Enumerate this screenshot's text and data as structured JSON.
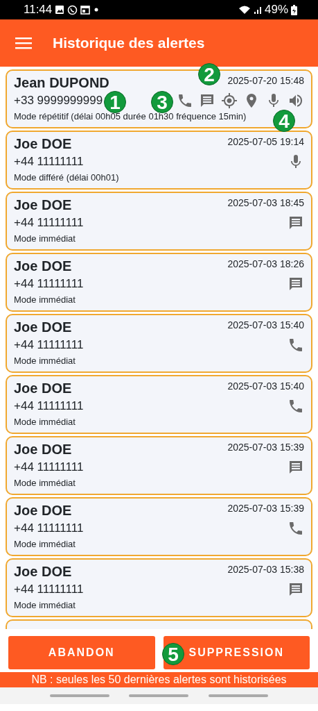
{
  "status_bar": {
    "time": "11:44",
    "battery": "49%"
  },
  "header": {
    "title": "Historique des alertes"
  },
  "alerts": [
    {
      "name": "Jean DUPOND",
      "phone": "+33 9999999999",
      "date": "2025-07-20 15:48",
      "mode": "Mode répétitif (délai 00h05 durée 01h30 fréquence 15min)",
      "icons": [
        {
          "kind": "call"
        },
        {
          "kind": "message"
        },
        {
          "kind": "target"
        },
        {
          "kind": "pin"
        },
        {
          "kind": "mic"
        },
        {
          "kind": "speaker"
        }
      ]
    },
    {
      "name": "Joe DOE",
      "phone": "+44 11111111",
      "date": "2025-07-05 19:14",
      "mode": "Mode différé (délai 00h01)",
      "icons": [
        {
          "kind": "mic"
        }
      ]
    },
    {
      "name": "Joe DOE",
      "phone": "+44 11111111",
      "date": "2025-07-03 18:45",
      "mode": "Mode immédiat",
      "icons": [
        {
          "kind": "message"
        }
      ]
    },
    {
      "name": "Joe DOE",
      "phone": "+44 11111111",
      "date": "2025-07-03 18:26",
      "mode": "Mode immédiat",
      "icons": [
        {
          "kind": "message"
        }
      ]
    },
    {
      "name": "Joe DOE",
      "phone": "+44 11111111",
      "date": "2025-07-03 15:40",
      "mode": "Mode immédiat",
      "icons": [
        {
          "kind": "call"
        }
      ]
    },
    {
      "name": "Joe DOE",
      "phone": "+44 11111111",
      "date": "2025-07-03 15:40",
      "mode": "Mode immédiat",
      "icons": [
        {
          "kind": "call"
        }
      ]
    },
    {
      "name": "Joe DOE",
      "phone": "+44 11111111",
      "date": "2025-07-03 15:39",
      "mode": "Mode immédiat",
      "icons": [
        {
          "kind": "message"
        }
      ]
    },
    {
      "name": "Joe DOE",
      "phone": "+44 11111111",
      "date": "2025-07-03 15:39",
      "mode": "Mode immédiat",
      "icons": [
        {
          "kind": "call"
        }
      ]
    },
    {
      "name": "Joe DOE",
      "phone": "+44 11111111",
      "date": "2025-07-03 15:38",
      "mode": "Mode immédiat",
      "icons": [
        {
          "kind": "message"
        }
      ]
    }
  ],
  "buttons": [
    {
      "label": "ABANDON"
    },
    {
      "label": "SUPPRESSION"
    }
  ],
  "footer_note": "NB : seules les 50 dernières alertes sont historisées",
  "callouts": [
    {
      "label": "1"
    },
    {
      "label": "2"
    },
    {
      "label": "3"
    },
    {
      "label": "4"
    },
    {
      "label": "5"
    }
  ]
}
